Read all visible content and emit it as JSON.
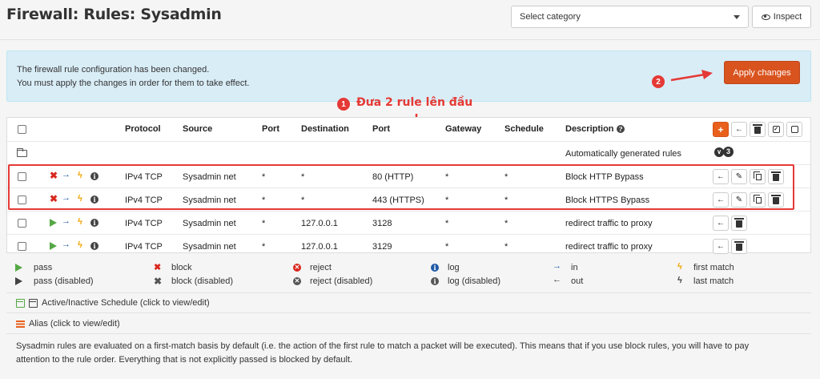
{
  "header": {
    "title": "Firewall: Rules: Sysadmin",
    "category_placeholder": "Select category",
    "inspect_label": "Inspect"
  },
  "alert": {
    "line1": "The firewall rule configuration has been changed.",
    "line2": "You must apply the changes in order for them to take effect.",
    "apply_label": "Apply changes"
  },
  "annotations": {
    "step1_num": "1",
    "step1_text": "Đưa 2 rule lên đầu",
    "step2_num": "2",
    "color": "#e53935"
  },
  "table": {
    "columns": [
      "Protocol",
      "Source",
      "Port",
      "Destination",
      "Port",
      "Gateway",
      "Schedule",
      "Description"
    ],
    "auto_rules_label": "Automatically generated rules",
    "auto_rules_count": "3",
    "rows": [
      {
        "action": "block",
        "protocol": "IPv4 TCP",
        "source": "Sysadmin net",
        "port": "*",
        "destination": "*",
        "dest_port": "80 (HTTP)",
        "gateway": "*",
        "schedule": "*",
        "description": "Block HTTP Bypass"
      },
      {
        "action": "block",
        "protocol": "IPv4 TCP",
        "source": "Sysadmin net",
        "port": "*",
        "destination": "*",
        "dest_port": "443 (HTTPS)",
        "gateway": "*",
        "schedule": "*",
        "description": "Block HTTPS Bypass"
      },
      {
        "action": "pass",
        "protocol": "IPv4 TCP",
        "source": "Sysadmin net",
        "port": "*",
        "destination": "127.0.0.1",
        "dest_port": "3128",
        "gateway": "*",
        "schedule": "*",
        "description": "redirect traffic to proxy"
      },
      {
        "action": "pass",
        "protocol": "IPv4 TCP",
        "source": "Sysadmin net",
        "port": "*",
        "destination": "127.0.0.1",
        "dest_port": "3129",
        "gateway": "*",
        "schedule": "*",
        "description": "redirect traffic to proxy"
      }
    ]
  },
  "legend": {
    "pass": "pass",
    "pass_disabled": "pass (disabled)",
    "block": "block",
    "block_disabled": "block (disabled)",
    "reject": "reject",
    "reject_disabled": "reject (disabled)",
    "log": "log",
    "log_disabled": "log (disabled)",
    "in": "in",
    "out": "out",
    "first_match": "first match",
    "last_match": "last match"
  },
  "footer": {
    "schedule_note": "Active/Inactive Schedule (click to view/edit)",
    "alias_note": "Alias (click to view/edit)",
    "info_line1": "Sysadmin rules are evaluated on a first-match basis by default (i.e. the action of the first rule to match a packet will be executed). This means that if you use block rules, you will have to pay",
    "info_line2": "attention to the rule order. Everything that is not explicitly passed is blocked by default."
  },
  "colors": {
    "accent": "#d9531e",
    "alert_bg": "#d9edf7",
    "block": "#d9271e",
    "pass": "#55a845",
    "direction": "#1f5aa6",
    "first_match": "#f0a400"
  }
}
